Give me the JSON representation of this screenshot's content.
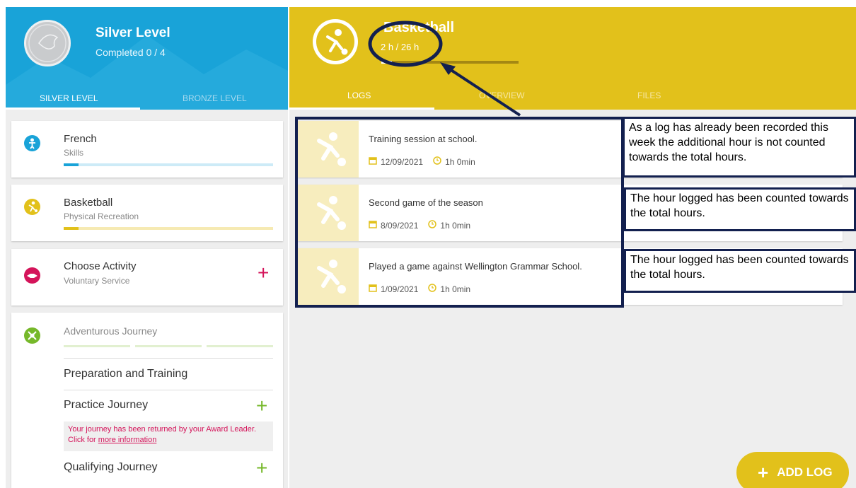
{
  "left_header": {
    "title": "Silver Level",
    "subtitle": "Completed 0 / 4",
    "tabs": [
      {
        "label": "SILVER LEVEL",
        "active": true
      },
      {
        "label": "BRONZE LEVEL",
        "active": false
      }
    ]
  },
  "activities": [
    {
      "title": "French",
      "section": "Skills",
      "icon": "skills-icon",
      "color": "#19a3d8",
      "progress": 0.07
    },
    {
      "title": "Basketball",
      "section": "Physical Recreation",
      "icon": "basketball-player-icon",
      "color": "#e2c11b",
      "progress": 0.07
    },
    {
      "title": "Choose Activity",
      "section": "Voluntary Service",
      "icon": "handshake-icon",
      "color": "#d4145a",
      "action": "plus-icon"
    }
  ],
  "adventurous": {
    "title": "Adventurous Journey",
    "icon": "compass-icon",
    "color": "#76b82a",
    "items": [
      {
        "label": "Preparation and Training"
      },
      {
        "label": "Practice Journey",
        "action": "plus-icon"
      },
      {
        "label": "Qualifying Journey",
        "action": "plus-icon"
      }
    ],
    "warning_text": "Your journey has been returned by your Award Leader. Click for ",
    "warning_link": "more information"
  },
  "activity_header": {
    "title": "Basketball",
    "hours": "2 h / 26 h",
    "progress": 0.077,
    "tabs": [
      {
        "label": "LOGS",
        "active": true
      },
      {
        "label": "OVERVIEW",
        "active": false
      },
      {
        "label": "FILES",
        "active": false
      }
    ]
  },
  "logs": [
    {
      "title": "Training session at school.",
      "date": "12/09/2021",
      "duration": "1h 0min"
    },
    {
      "title": "Second game of the season",
      "date": "8/09/2021",
      "duration": "1h 0min"
    },
    {
      "title": "Played a game against Wellington Grammar School.",
      "date": "1/09/2021",
      "duration": "1h 0min"
    }
  ],
  "notes": [
    "As a log has already been recorded this week the additional hour is not counted towards the total hours.",
    "The hour logged has been counted towards the total hours.",
    "The hour logged has been counted towards the total hours."
  ],
  "add_log_label": "ADD LOG",
  "colors": {
    "blue": "#19a3d8",
    "yellow": "#e2c11b",
    "red": "#d4145a",
    "green": "#76b82a",
    "annotation": "#13204f"
  }
}
